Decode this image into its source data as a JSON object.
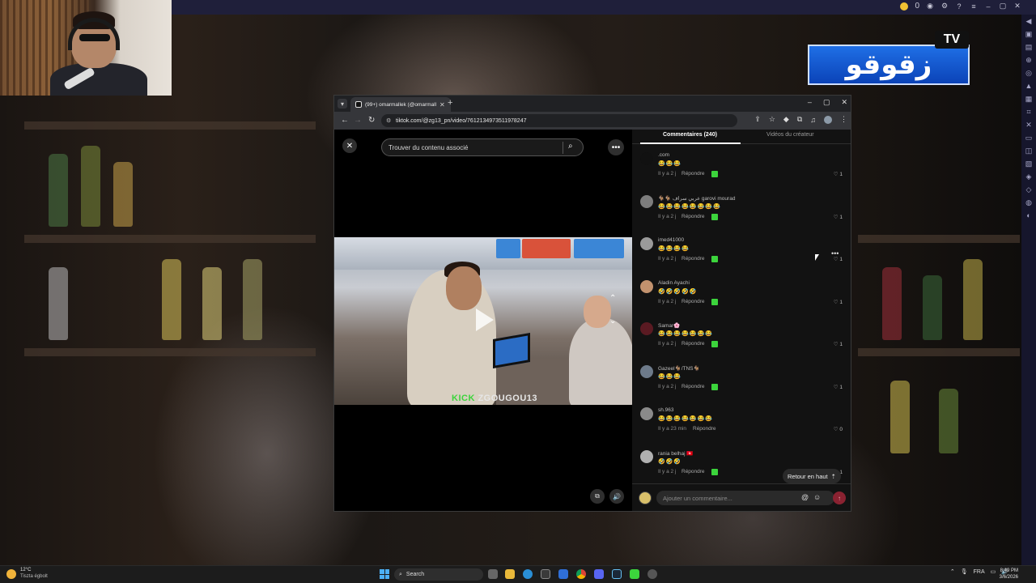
{
  "overlay": {
    "coin_count": "0",
    "logo_text": "زقوقو",
    "logo_tv": "TV"
  },
  "browser": {
    "tab_title": "(99+) omarmallek (@omarmallek)",
    "url": "tiktok.com/@zg13_pn/video/7612134973511978247"
  },
  "tiktok": {
    "search_placeholder": "Trouver du contenu associé",
    "watermark_prefix": "KICK",
    "watermark_text": "ZGOUGOU13",
    "tabs": [
      "Commentaires (240)",
      "Vidéos du créateur"
    ],
    "back_to_top": "Retour en haut",
    "comment_placeholder": "Ajouter un commentaire...",
    "comments": [
      {
        "user": ".com",
        "text": "😂😂😂",
        "time": "Il y a 2 j",
        "reply": "Répondre",
        "likes": "1",
        "avatar_color": "#111111"
      },
      {
        "user": "🐐🐐 عربي سراف garovi mourad",
        "text": "😂😂😂😂😂😂😂😂",
        "time": "Il y a 2 j",
        "reply": "Répondre",
        "likes": "1",
        "avatar_color": "#7d7d7d"
      },
      {
        "user": "imed41000",
        "text": "😂😂😂😂",
        "time": "Il y a 2 j",
        "reply": "Répondre",
        "likes": "1",
        "avatar_color": "#9a9a9a"
      },
      {
        "user": "Aladin Ayachi",
        "text": "🤣🤣🤣🤣🤣",
        "time": "Il y a 2 j",
        "reply": "Répondre",
        "likes": "1",
        "avatar_color": "#c2926e"
      },
      {
        "user": "Samar🌸",
        "text": "😂😂😂😂😂😂😂",
        "time": "Il y a 2 j",
        "reply": "Répondre",
        "likes": "1",
        "avatar_color": "#5a1a22"
      },
      {
        "user": "Gazeel🐐/TNS🐐",
        "text": "😂😂😂",
        "time": "Il y a 2 j",
        "reply": "Répondre",
        "likes": "1",
        "avatar_color": "#6d7a8a"
      },
      {
        "user": "sh.963",
        "text": "😂😂😂😂😂😂😂",
        "time": "Il y a 23 min",
        "reply": "Répondre",
        "likes": "0",
        "avatar_color": "#8a8a8a"
      },
      {
        "user": "rania belhaj 🇹🇳",
        "text": "🤣🤣🤣",
        "time": "Il y a 2 j",
        "reply": "Répondre",
        "likes": "1",
        "avatar_color": "#b0b0b0"
      }
    ]
  },
  "taskbar": {
    "temperature": "12°C",
    "weather": "Tiszta égbolt",
    "search_label": "Search",
    "lang": "FRA",
    "time": "8:49 PM",
    "date": "3/6/2026"
  }
}
